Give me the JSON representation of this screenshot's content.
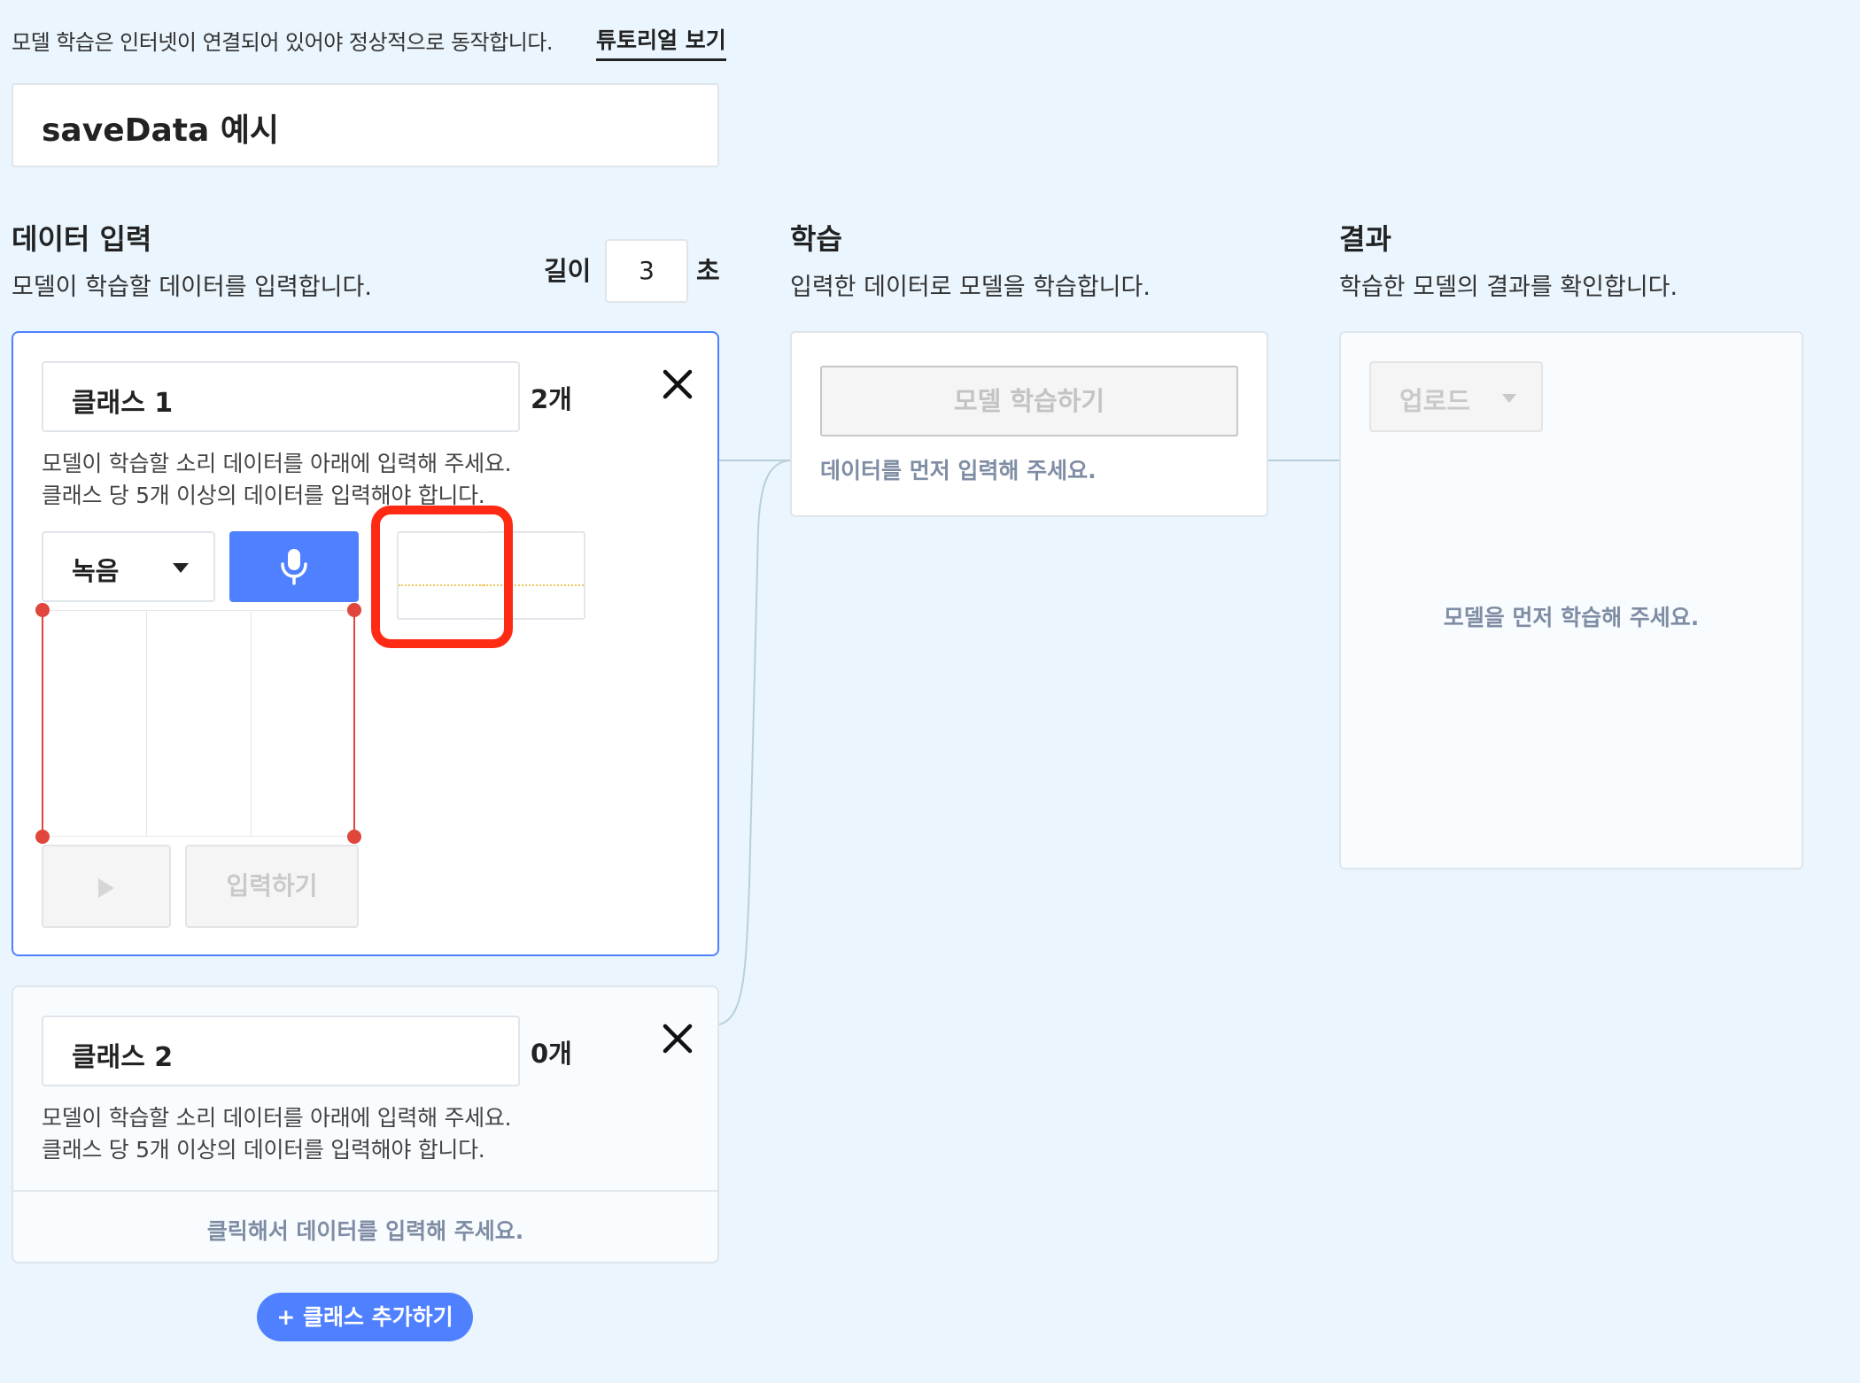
{
  "notice": {
    "text": "모델 학습은 인터넷이 연결되어 있어야 정상적으로 동작합니다.",
    "tutorial_link": "튜토리얼 보기"
  },
  "project": {
    "title": "saveData 예시"
  },
  "data_input": {
    "title": "데이터 입력",
    "description": "모델이 학습할 데이터를 입력합니다.",
    "length_label": "길이",
    "length_value": "3",
    "length_unit": "초"
  },
  "classes": [
    {
      "name": "클래스 1",
      "count": "2개",
      "desc_line1": "모델이 학습할 소리 데이터를 아래에 입력해 주세요.",
      "desc_line2": "클래스 당 5개 이상의 데이터를 입력해야 합니다.",
      "source_select": "녹음",
      "input_button": "입력하기"
    },
    {
      "name": "클래스 2",
      "count": "0개",
      "desc_line1": "모델이 학습할 소리 데이터를 아래에 입력해 주세요.",
      "desc_line2": "클래스 당 5개 이상의 데이터를 입력해야 합니다.",
      "click_hint": "클릭해서 데이터를 입력해 주세요."
    }
  ],
  "add_class_button": "+ 클래스 추가하기",
  "train": {
    "title": "학습",
    "description": "입력한 데이터로 모델을 학습합니다.",
    "button": "모델 학습하기",
    "hint": "데이터를 먼저 입력해 주세요."
  },
  "result": {
    "title": "결과",
    "description": "학습한 모델의 결과를 확인합니다.",
    "upload_select": "업로드",
    "hint": "모델을 먼저 학습해 주세요."
  },
  "icons": {
    "close": "close-icon",
    "mic": "microphone-icon",
    "play": "play-icon",
    "dropdown": "chevron-down-icon"
  },
  "colors": {
    "accent": "#4f80ff",
    "background": "#eaf5fd",
    "highlight": "#ff2a13",
    "crop_marker": "#e0463c",
    "hint_text": "#7f8da4"
  }
}
